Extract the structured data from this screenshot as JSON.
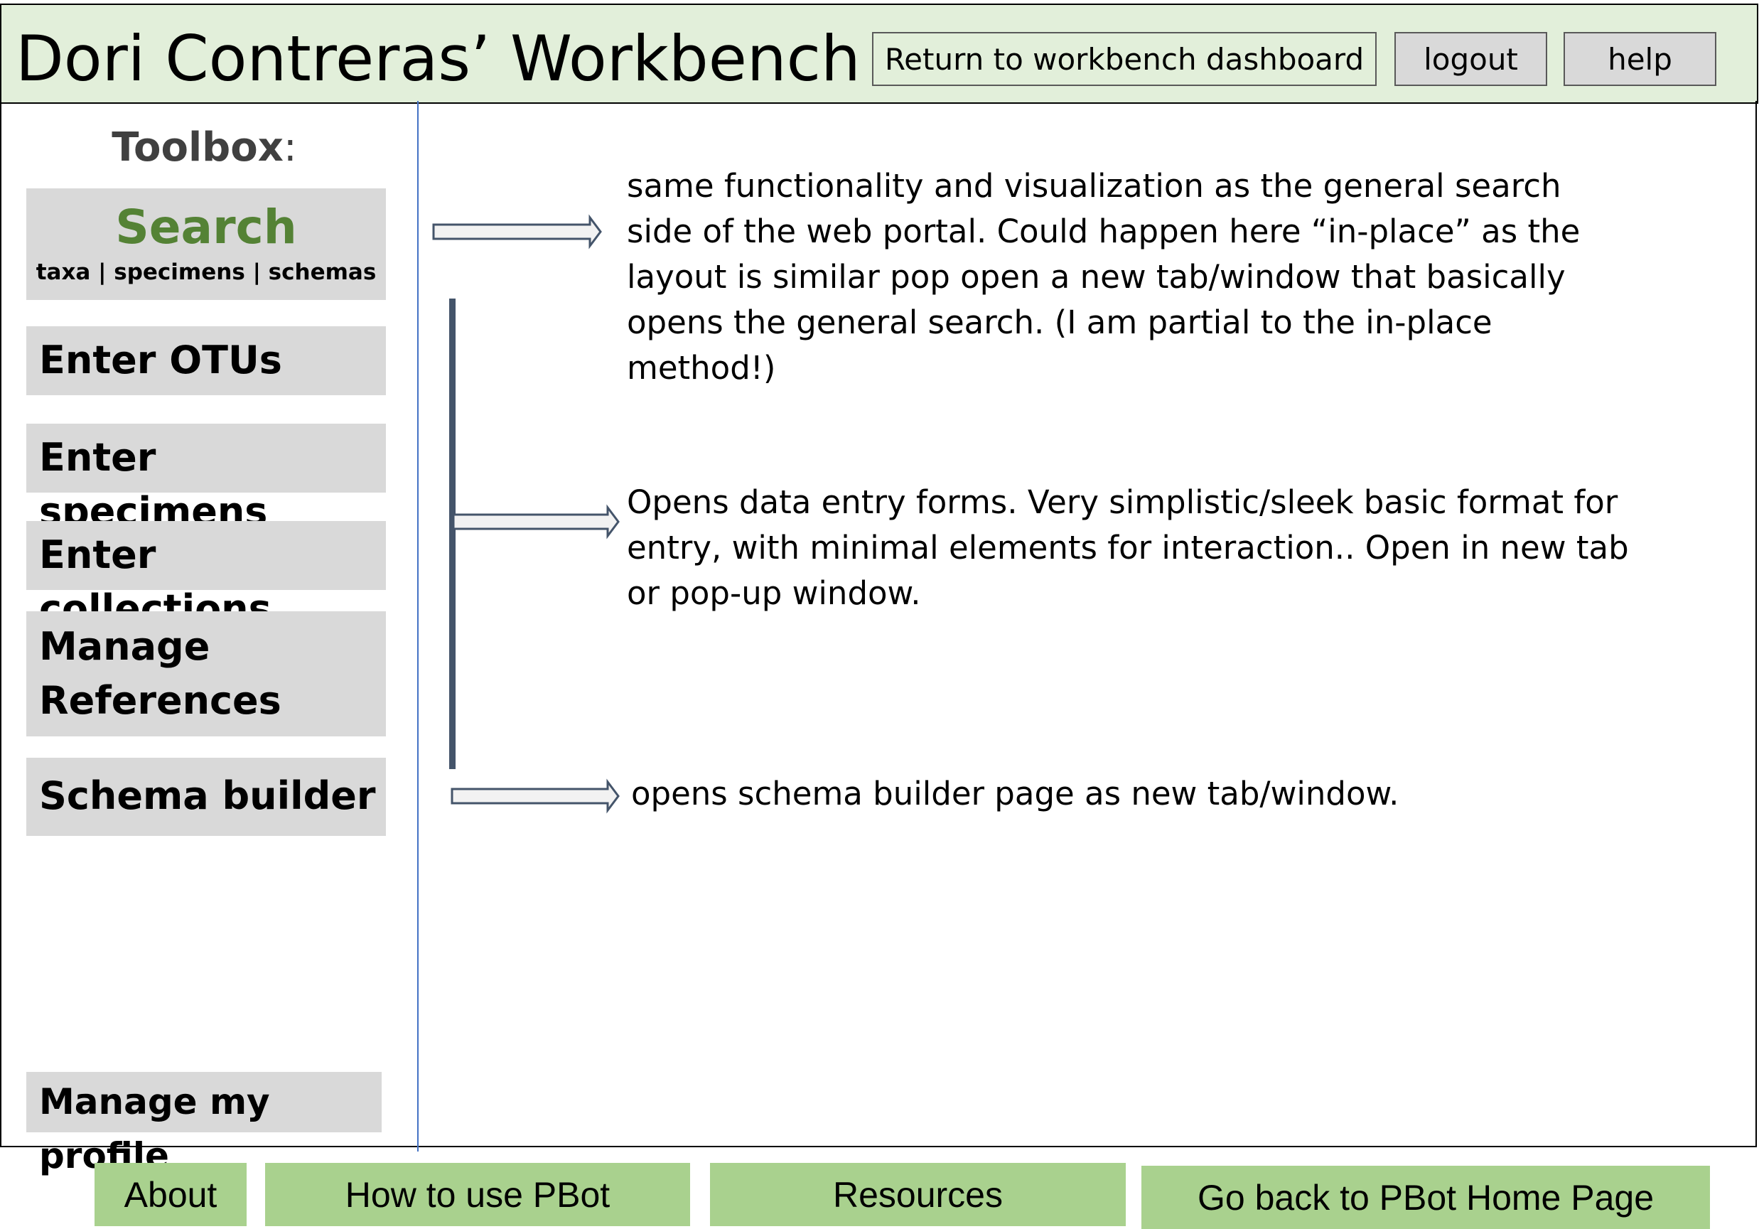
{
  "header": {
    "title": "Dori Contreras’ Workbench",
    "buttons": {
      "dashboard": "Return to workbench dashboard",
      "logout": "logout",
      "help": "help"
    }
  },
  "toolbox": {
    "title": "Toolbox",
    "title_suffix": ":",
    "search": {
      "label": "Search",
      "sublinks": "taxa | specimens | schemas"
    },
    "items": {
      "otus": "Enter OTUs",
      "specimens": "Enter specimens",
      "collections": "Enter collections",
      "references_line1": "Manage",
      "references_line2": "References",
      "schema": "Schema builder"
    },
    "profile": "Manage my profile"
  },
  "annotations": {
    "search_note": "same functionality and visualization as the general search side of the web portal. Could  happen here “in-place” as the layout is similar pop open a new tab/window that basically opens the general search. (I am partial to the in-place method!)",
    "entry_note": "Opens data entry forms. Very simplistic/sleek basic format for entry, with minimal elements for interaction.. Open in new tab or pop-up window.",
    "schema_note": "opens schema builder page as new tab/window."
  },
  "footer": {
    "about": "About",
    "howto": "How to use PBot",
    "resources": "Resources",
    "home": "Go back to PBot Home Page"
  },
  "colors": {
    "header_bg": "#e2efda",
    "button_gray": "#d9d9d9",
    "search_green": "#548235",
    "footer_green": "#a9d18e",
    "divider_blue": "#4472c4",
    "bracket": "#44546a"
  }
}
